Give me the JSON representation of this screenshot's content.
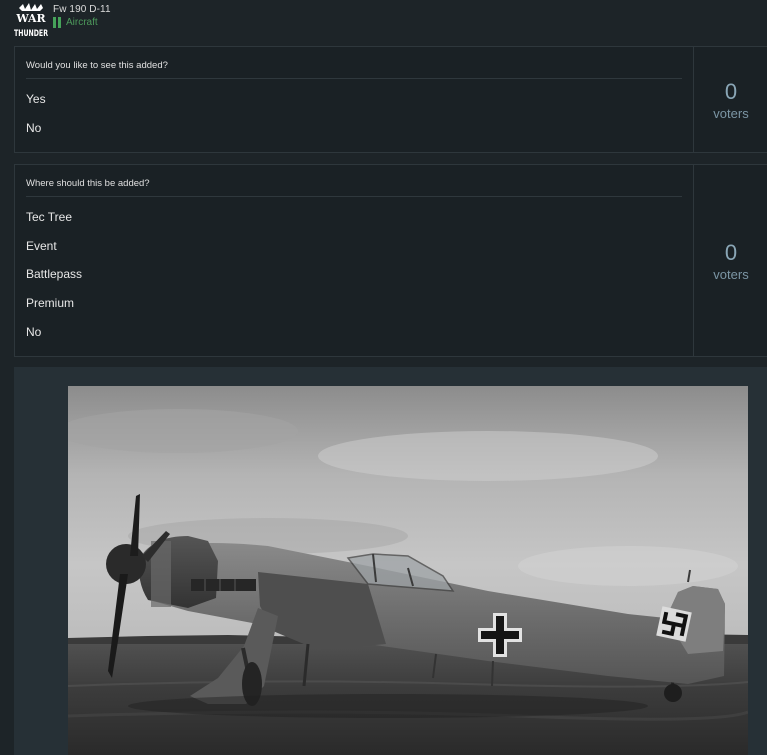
{
  "header": {
    "logo_icon": "war-thunder-logo",
    "logo_text_top": "WAR",
    "logo_text_bottom": "THUNDER",
    "title": "Fw 190 D-11",
    "category": "Aircraft",
    "category_color": "#4d9a5c"
  },
  "polls": [
    {
      "question": "Would you like to see this added?",
      "options": [
        "Yes",
        "No"
      ],
      "votes": "0",
      "votes_label": "voters"
    },
    {
      "question": "Where should this be added?",
      "options": [
        "Tec Tree",
        "Event",
        "Battlepass",
        "Premium",
        "No"
      ],
      "votes": "0",
      "votes_label": "voters"
    }
  ],
  "post": {
    "image_description": "black-and-white-photo-fw190-aircraft"
  },
  "colors": {
    "background": "#1d2428",
    "panel": "#1a2125",
    "border": "#2e373c",
    "vote_count": "#8aa6b6"
  }
}
